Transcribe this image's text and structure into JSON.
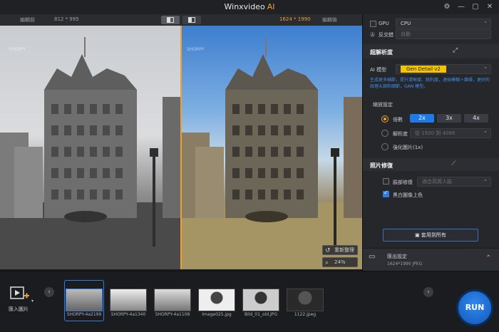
{
  "app": {
    "title": "Winxvideo",
    "title_ai": "AI"
  },
  "window": {
    "settings_icon": "gear-icon",
    "minimize": "—",
    "restore": "▢",
    "close": "✕"
  },
  "compare": {
    "before_label": "編輯前",
    "before_res": "812 * 995",
    "after_res": "1624 * 1990",
    "after_label": "編輯後"
  },
  "preview": {
    "watermark": "SHORPY",
    "reset_label": "重新整理",
    "zoom_label": "24%"
  },
  "panel": {
    "gpu_label": "GPU",
    "device_value": "CPU",
    "deinterlace_label": "反交錯",
    "deinterlace_value": "自動",
    "super_res_title": "超解析度",
    "ai_model_label": "AI 模型",
    "ai_model_value": "Gen Detail v2",
    "description": "生成更多細節，提升清晰度、銳利度，適採模糊＋雜噪，更好的紋理＆調和細節，GAN 模型。",
    "scale_settings_label": "縮放設定",
    "scale_option_label": "倍數",
    "scale_values": [
      "2x",
      "3x",
      "4x"
    ],
    "resolution_option_label": "解析度",
    "resolution_value": "從 1920 到 4096",
    "enhance_option_label": "強化圖片(1x)",
    "photo_restore_title": "照片修復",
    "face_restore_label": "臉部修復",
    "face_restore_value": "適合高質人臉",
    "colorize_label": "黑白圖像上色",
    "apply_all_label": "套用到所有",
    "export_title": "匯出設定",
    "export_details": "1624*1990  JPEG"
  },
  "strip": {
    "import_label": "匯入圖片",
    "thumbnails": [
      {
        "label": "SHORPY-4a2199"
      },
      {
        "label": "SHORPY-4a1340"
      },
      {
        "label": "SHORPY-4a1108"
      },
      {
        "label": "Image025.jpg"
      },
      {
        "label": "Bild_01_old.JPG"
      },
      {
        "label": "1122.jpeg"
      }
    ],
    "run_label": "RUN"
  },
  "colors": {
    "accent": "#f0a030",
    "primary": "#1e7be6",
    "model_badge": "#f5c400"
  }
}
